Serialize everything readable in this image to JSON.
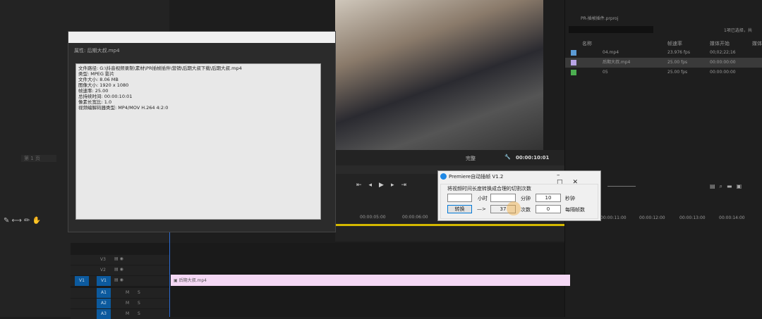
{
  "properties": {
    "title": "属性: 后期大叔.mp4",
    "lines": [
      "文件路径: G:\\抖音视频录制\\素材\\PR插帧插件\\营销\\后期大叔下载\\后期大叔.mp4",
      "类型: MPEG 影片",
      "文件大小: 8.06 MB",
      "图像大小: 1920 x 1080",
      "帧速率: 25.00",
      "总持续时间: 00:00:10:01",
      "像素长宽比: 1.0",
      "视频编解码器类型: MP4/MOV H.264 4:2:0"
    ]
  },
  "monitor": {
    "quality": "完整",
    "timecode": "00:00:10:01"
  },
  "project": {
    "name": "PR-插帧插件.prproj",
    "selection": "1项已选择，共",
    "columns": [
      "名称",
      "帧速率",
      "媒体开始",
      "媒体"
    ],
    "rows": [
      {
        "name": "04.mp4",
        "fps": "23.976 fps",
        "start": "00;02;22;16",
        "color": "#5b9bd5"
      },
      {
        "name": "后期大叔.mp4",
        "fps": "25.00 fps",
        "start": "00:00:00:00",
        "color": "#b9a5e6"
      },
      {
        "name": "05",
        "fps": "25.00 fps",
        "start": "00:00:00:00",
        "color": "#4caf50"
      }
    ]
  },
  "dialog": {
    "title": "Premiere自动插帧 V1.2",
    "heading": "将视频时间长度转换成合理的切割次数",
    "hour_label": "小时",
    "min_label": "分钟",
    "min_value": "10",
    "sec_label": "秒钟",
    "convert": "转换",
    "arrow": "—>",
    "result": "37",
    "times_label": "次数",
    "times_value": "0",
    "per_label": "每隔帧数"
  },
  "timeline": {
    "ticks": [
      "00:00:05:00",
      "00:00:06:00",
      "00:00:11:00",
      "00:00:12:00",
      "00:00:13:00",
      "00:00:14:00"
    ],
    "tracks": [
      "V3",
      "V2",
      "V1",
      "A1",
      "A2",
      "A3"
    ],
    "src": "V1",
    "clip": "后期大叔.mp4",
    "m": "M",
    "s": "S"
  },
  "left": {
    "seq": "第 1 页"
  }
}
